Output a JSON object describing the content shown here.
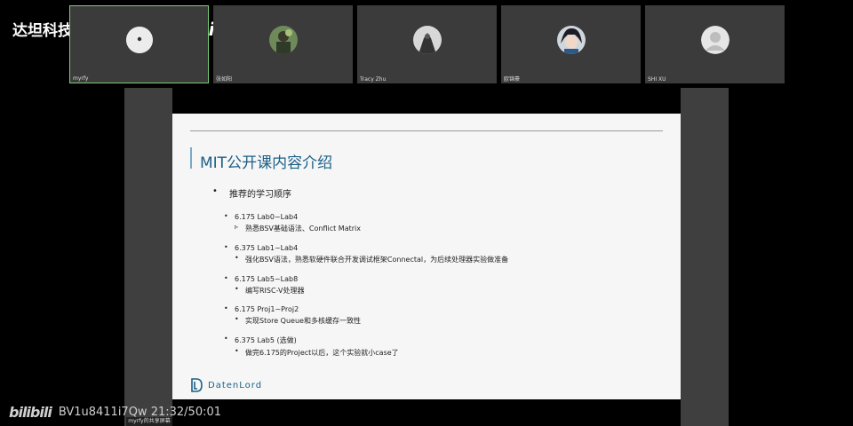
{
  "watermark": {
    "text": "达坦科技DatenLord",
    "logo": "bilibili"
  },
  "participants": [
    {
      "name": "myrfy",
      "avatar_icon": "small-white-avatar-icon",
      "active": true
    },
    {
      "name": "张如阳",
      "avatar_icon": "photo-avatar-icon",
      "active": false
    },
    {
      "name": "Tracy Zhu",
      "avatar_icon": "photo-avatar-icon",
      "active": false
    },
    {
      "name": "欧锦豪",
      "avatar_icon": "anime-avatar-icon",
      "active": false
    },
    {
      "name": "SHI XU",
      "avatar_icon": "default-person-icon",
      "active": false
    }
  ],
  "slide": {
    "title": "MIT公开课内容介绍",
    "main_bullet": "推荐的学习顺序",
    "items": [
      {
        "course": "6.175  Lab0~Lab4",
        "detail": "熟悉BSV基础语法、Conflict Matrix"
      },
      {
        "course": "6.375  Lab1~Lab4",
        "detail": "强化BSV语法，熟悉软硬件联合开发调试框架Connectal，为后续处理器实验做准备"
      },
      {
        "course": "6.175  Lab5~Lab8",
        "detail": "编写RISC-V处理器"
      },
      {
        "course": "6.175  Proj1~Proj2",
        "detail": "实现Store Queue和多核缓存一致性"
      },
      {
        "course": "6.375  Lab5 (选做)",
        "detail": "做完6.175的Project以后，这个实验就小case了"
      }
    ],
    "logo_text": "DatenLord"
  },
  "footer": {
    "logo": "bilibili",
    "video_info": "BV1u8411i7Qw 21:32/50:01"
  },
  "share_label": "myrfy的共享屏幕",
  "colors": {
    "slide_title": "#1b5f87",
    "tile_bg": "#3b3b3b",
    "active_border": "#7bd07b"
  }
}
